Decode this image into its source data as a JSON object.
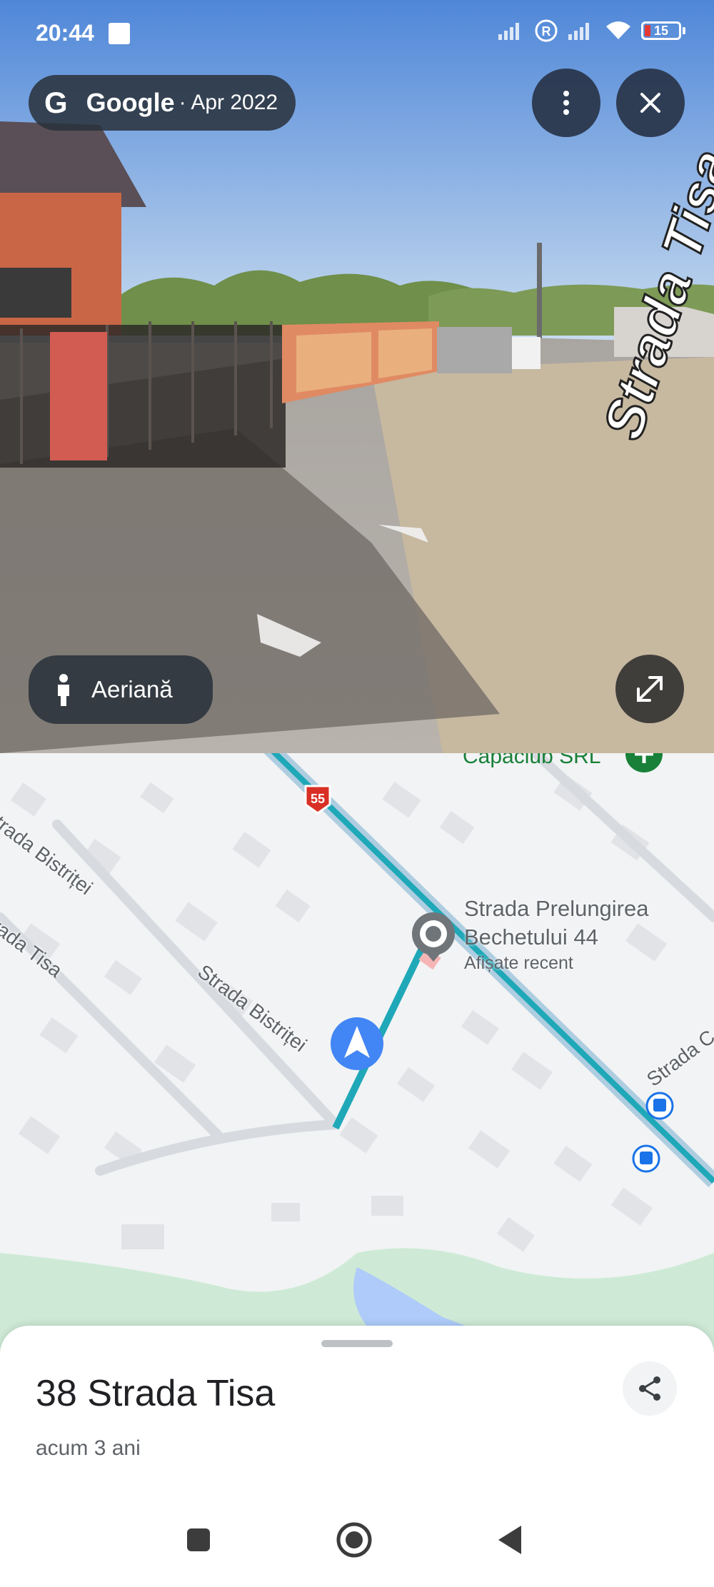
{
  "status_bar": {
    "time": "20:44",
    "battery": "15",
    "battery_level": 0.15
  },
  "streetview": {
    "google_label": "Google",
    "date": "· Apr 2022",
    "aerial_label": "Aeriană",
    "street_sign": "Strada Tisa"
  },
  "map": {
    "poi_top": "Capaclub SRL",
    "route_badge": "55",
    "street_bistritei_1": "Strada Bistriței",
    "street_bistritei_2": "Strada Bistriței",
    "street_tisa": "Strada Tisa",
    "street_c": "Strada C",
    "place_name_line1": "Strada Prelungirea",
    "place_name_line2": "Bechetului 44",
    "place_sub": "Afișate recent"
  },
  "sheet": {
    "title": "38 Strada Tisa",
    "subtitle": "acum 3 ani"
  },
  "icons": {
    "menu": "more-vert-icon",
    "close": "close-icon",
    "aerial": "person-icon",
    "expand": "fullscreen-icon",
    "share": "share-icon"
  }
}
